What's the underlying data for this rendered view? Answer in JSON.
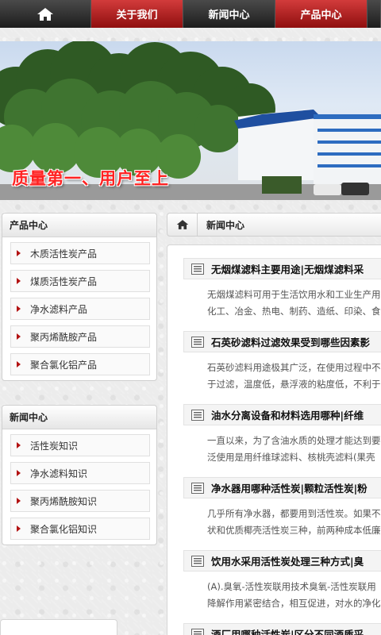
{
  "nav": {
    "home_icon": "home-icon",
    "items": [
      "关于我们",
      "新闻中心",
      "产品中心"
    ]
  },
  "banner": {
    "slogan": "质量第一、用户至上"
  },
  "sidebar": {
    "products": {
      "title": "产品中心",
      "items": [
        "木质活性炭产品",
        "煤质活性炭产品",
        "净水滤料产品",
        "聚丙烯酰胺产品",
        "聚合氯化铝产品"
      ]
    },
    "news": {
      "title": "新闻中心",
      "items": [
        "活性炭知识",
        "净水滤料知识",
        "聚丙烯酰胺知识",
        "聚合氯化铝知识"
      ]
    }
  },
  "breadcrumb": {
    "home_icon": "home-icon",
    "label": "新闻中心"
  },
  "articles": [
    {
      "title": "无烟煤滤料主要用途|无烟煤滤料采",
      "summary": [
        "无烟煤滤料可用于生活饮用水和工业生产用",
        "化工、冶金、热电、制药、造纸、印染、食"
      ]
    },
    {
      "title": "石英砂滤料过滤效果受到哪些因素影",
      "summary": [
        "石英砂滤料用途极其广泛，在使用过程中不",
        "于过滤，温度低，悬浮液的粘度低，不利于"
      ]
    },
    {
      "title": "油水分离设备和材料选用哪种|纤维",
      "summary": [
        "一直以来，为了含油水质的处理才能达到要",
        "泛使用是用纤维球滤料、核桃壳滤料(果壳"
      ]
    },
    {
      "title": "净水器用哪种活性炭|颗粒活性炭|粉",
      "summary": [
        "几乎所有净水器，都要用到活性炭。如果不",
        "状和优质椰壳活性炭三种，前两种成本低廉"
      ]
    },
    {
      "title": "饮用水采用活性炭处理三种方式|臭",
      "summary": [
        "(A).臭氧-活性炭联用技术臭氧-活性炭联用",
        "降解作用紧密结合，相互促进，对水的净化"
      ]
    },
    {
      "title": "酒厂用哪种活性炭|区分不同酒质采",
      "summary": []
    }
  ],
  "colors": {
    "nav_red": "#b71c1c",
    "nav_dark": "#2a2a2a",
    "accent_triangle": "#b31212",
    "slogan": "#ff2222"
  }
}
